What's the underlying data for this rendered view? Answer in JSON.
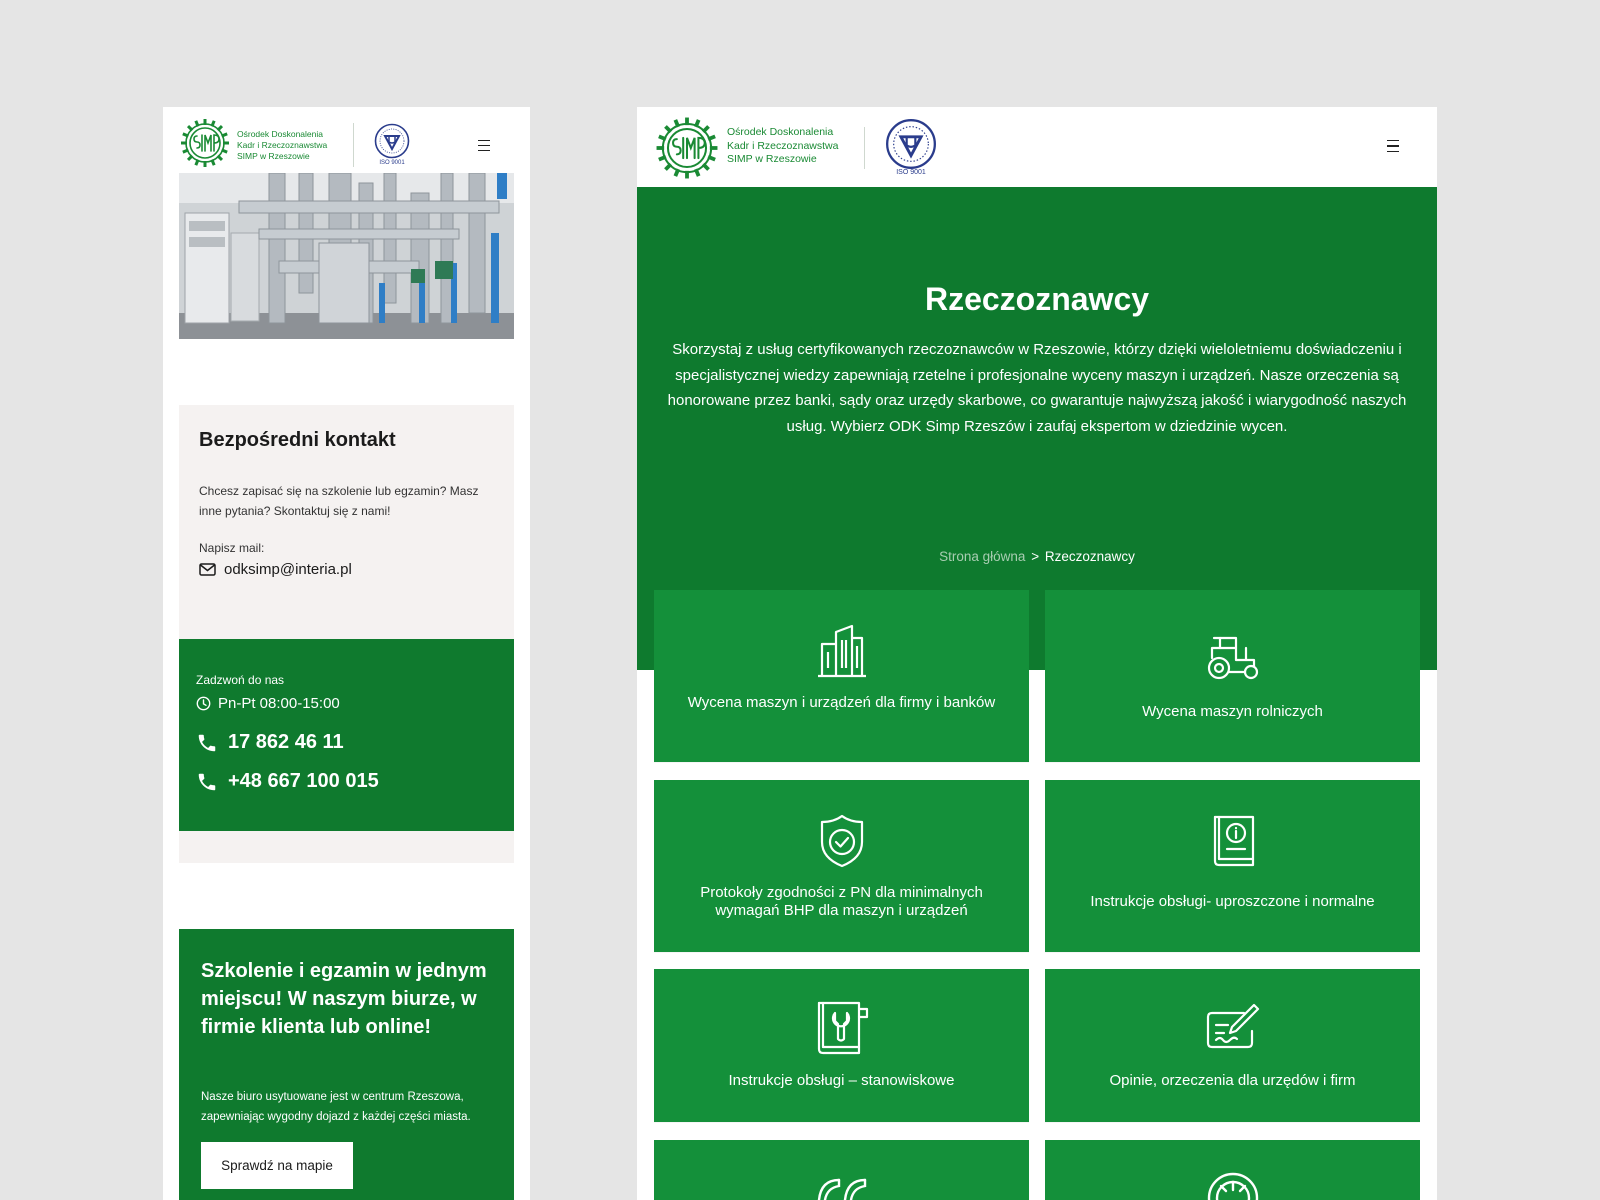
{
  "brand": {
    "line1": "Ośrodek Doskonalenia",
    "line2": "Kadr i Rzeczoznawstwa",
    "line3": "SIMP w Rzeszowie",
    "cert_caption": "ISO 9001",
    "color_green": "#1a8a34",
    "color_cert": "#2a3c8c"
  },
  "mobile": {
    "contact": {
      "title": "Bezpośredni kontakt",
      "intro": "Chcesz zapisać się na szkolenie lub egzamin? Masz inne pytania? Skontaktuj się z nami!",
      "mail_label": "Napisz mail:",
      "email": "odksimp@interia.pl"
    },
    "call": {
      "label": "Zadzwoń do nas",
      "hours": "Pn-Pt 08:00-15:00",
      "phone1": "17 862 46 11",
      "phone2": "+48 667 100 015"
    },
    "promo": {
      "title": "Szkolenie i egzamin w jednym miejscu! W naszym biurze, w firmie klienta lub online!",
      "text": "Nasze biuro usytuowane jest w centrum Rzeszowa, zapewniając wygodny dojazd z każdej części miasta.",
      "button": "Sprawdź na mapie"
    }
  },
  "desktop": {
    "hero": {
      "title": "Rzeczoznawcy",
      "description": "Skorzystaj z usług certyfikowanych rzeczoznawców w Rzeszowie, którzy dzięki wieloletniemu doświadczeniu i specjalistycznej wiedzy zapewniają rzetelne i profesjonalne wyceny maszyn i urządzeń. Nasze orzeczenia są honorowane przez banki, sądy oraz urzędy skarbowe, co gwarantuje najwyższą jakość i wiarygodność naszych usług. Wybierz ODK Simp Rzeszów i zaufaj ekspertom w dziedzinie wycen.",
      "breadcrumb_home": "Strona główna",
      "breadcrumb_sep": ">",
      "breadcrumb_current": "Rzeczoznawcy"
    },
    "cards": [
      {
        "title": "Wycena maszyn i urządzeń dla firmy i banków",
        "icon": "building-icon"
      },
      {
        "title": "Wycena maszyn rolniczych",
        "icon": "tractor-icon"
      },
      {
        "title": "Protokoły zgodności z PN dla minimalnych wymagań BHP dla maszyn i urządzeń",
        "icon": "shield-check-icon"
      },
      {
        "title": "Instrukcje obsługi- uproszczone i normalne",
        "icon": "manual-book-icon"
      },
      {
        "title": "Instrukcje obsługi – stanowiskowe",
        "icon": "wrench-book-icon"
      },
      {
        "title": "Opinie, orzeczenia dla urzędów i firm",
        "icon": "signature-icon"
      },
      {
        "title": "",
        "icon": "quote-icon"
      },
      {
        "title": "",
        "icon": "gauge-icon"
      }
    ],
    "colors": {
      "hero_bg": "#0e7a2e",
      "card_bg": "#14903a"
    }
  }
}
